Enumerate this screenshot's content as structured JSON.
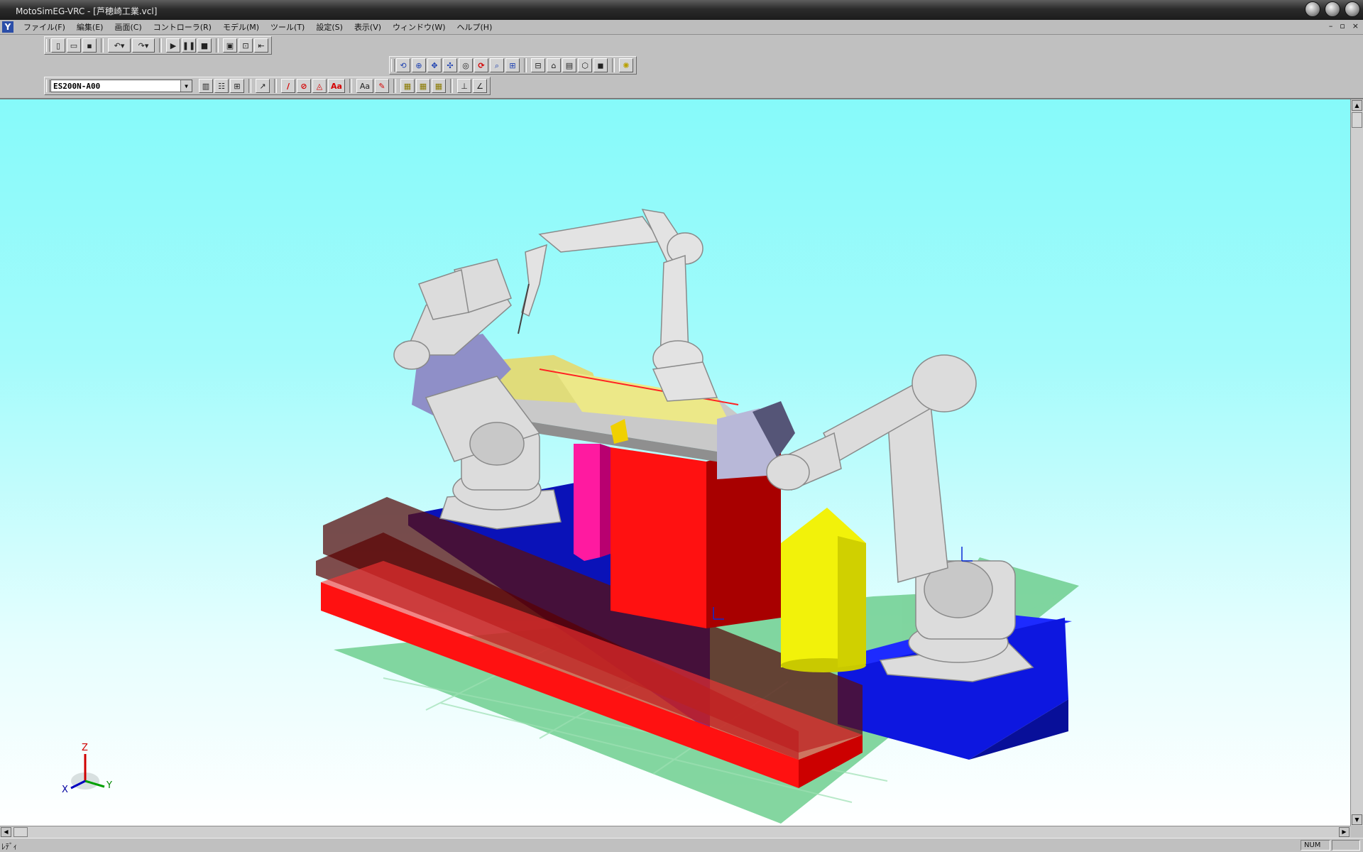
{
  "window": {
    "title": "MotoSimEG-VRC - [芦穂崎工業.vcl]"
  },
  "menu": {
    "items": [
      "ファイル(F)",
      "編集(E)",
      "画面(C)",
      "コントローラ(R)",
      "モデル(M)",
      "ツール(T)",
      "設定(S)",
      "表示(V)",
      "ウィンドウ(W)",
      "ヘルプ(H)"
    ],
    "mdi_controls": [
      "–",
      "▫",
      "×"
    ]
  },
  "toolbar": {
    "robot_selected": "ES200N-A00",
    "text_button": "Aa",
    "red_text_button": "Aa"
  },
  "viewport": {
    "background_top": "#86fafa",
    "background_bottom": "#ffffff",
    "axis_labels": {
      "x": "X",
      "y": "Y",
      "z": "Z"
    },
    "colors": {
      "floor_grid": "#6fcf8f",
      "red_block": "#ff1111",
      "blue_base": "#0d17e0",
      "yellow_tank": "#f2f20a",
      "pink_post": "#ff1aa0",
      "robot_body": "#dcdcdc"
    }
  },
  "status": {
    "left": "ﾚﾃﾞｨ",
    "num": "NUM"
  }
}
